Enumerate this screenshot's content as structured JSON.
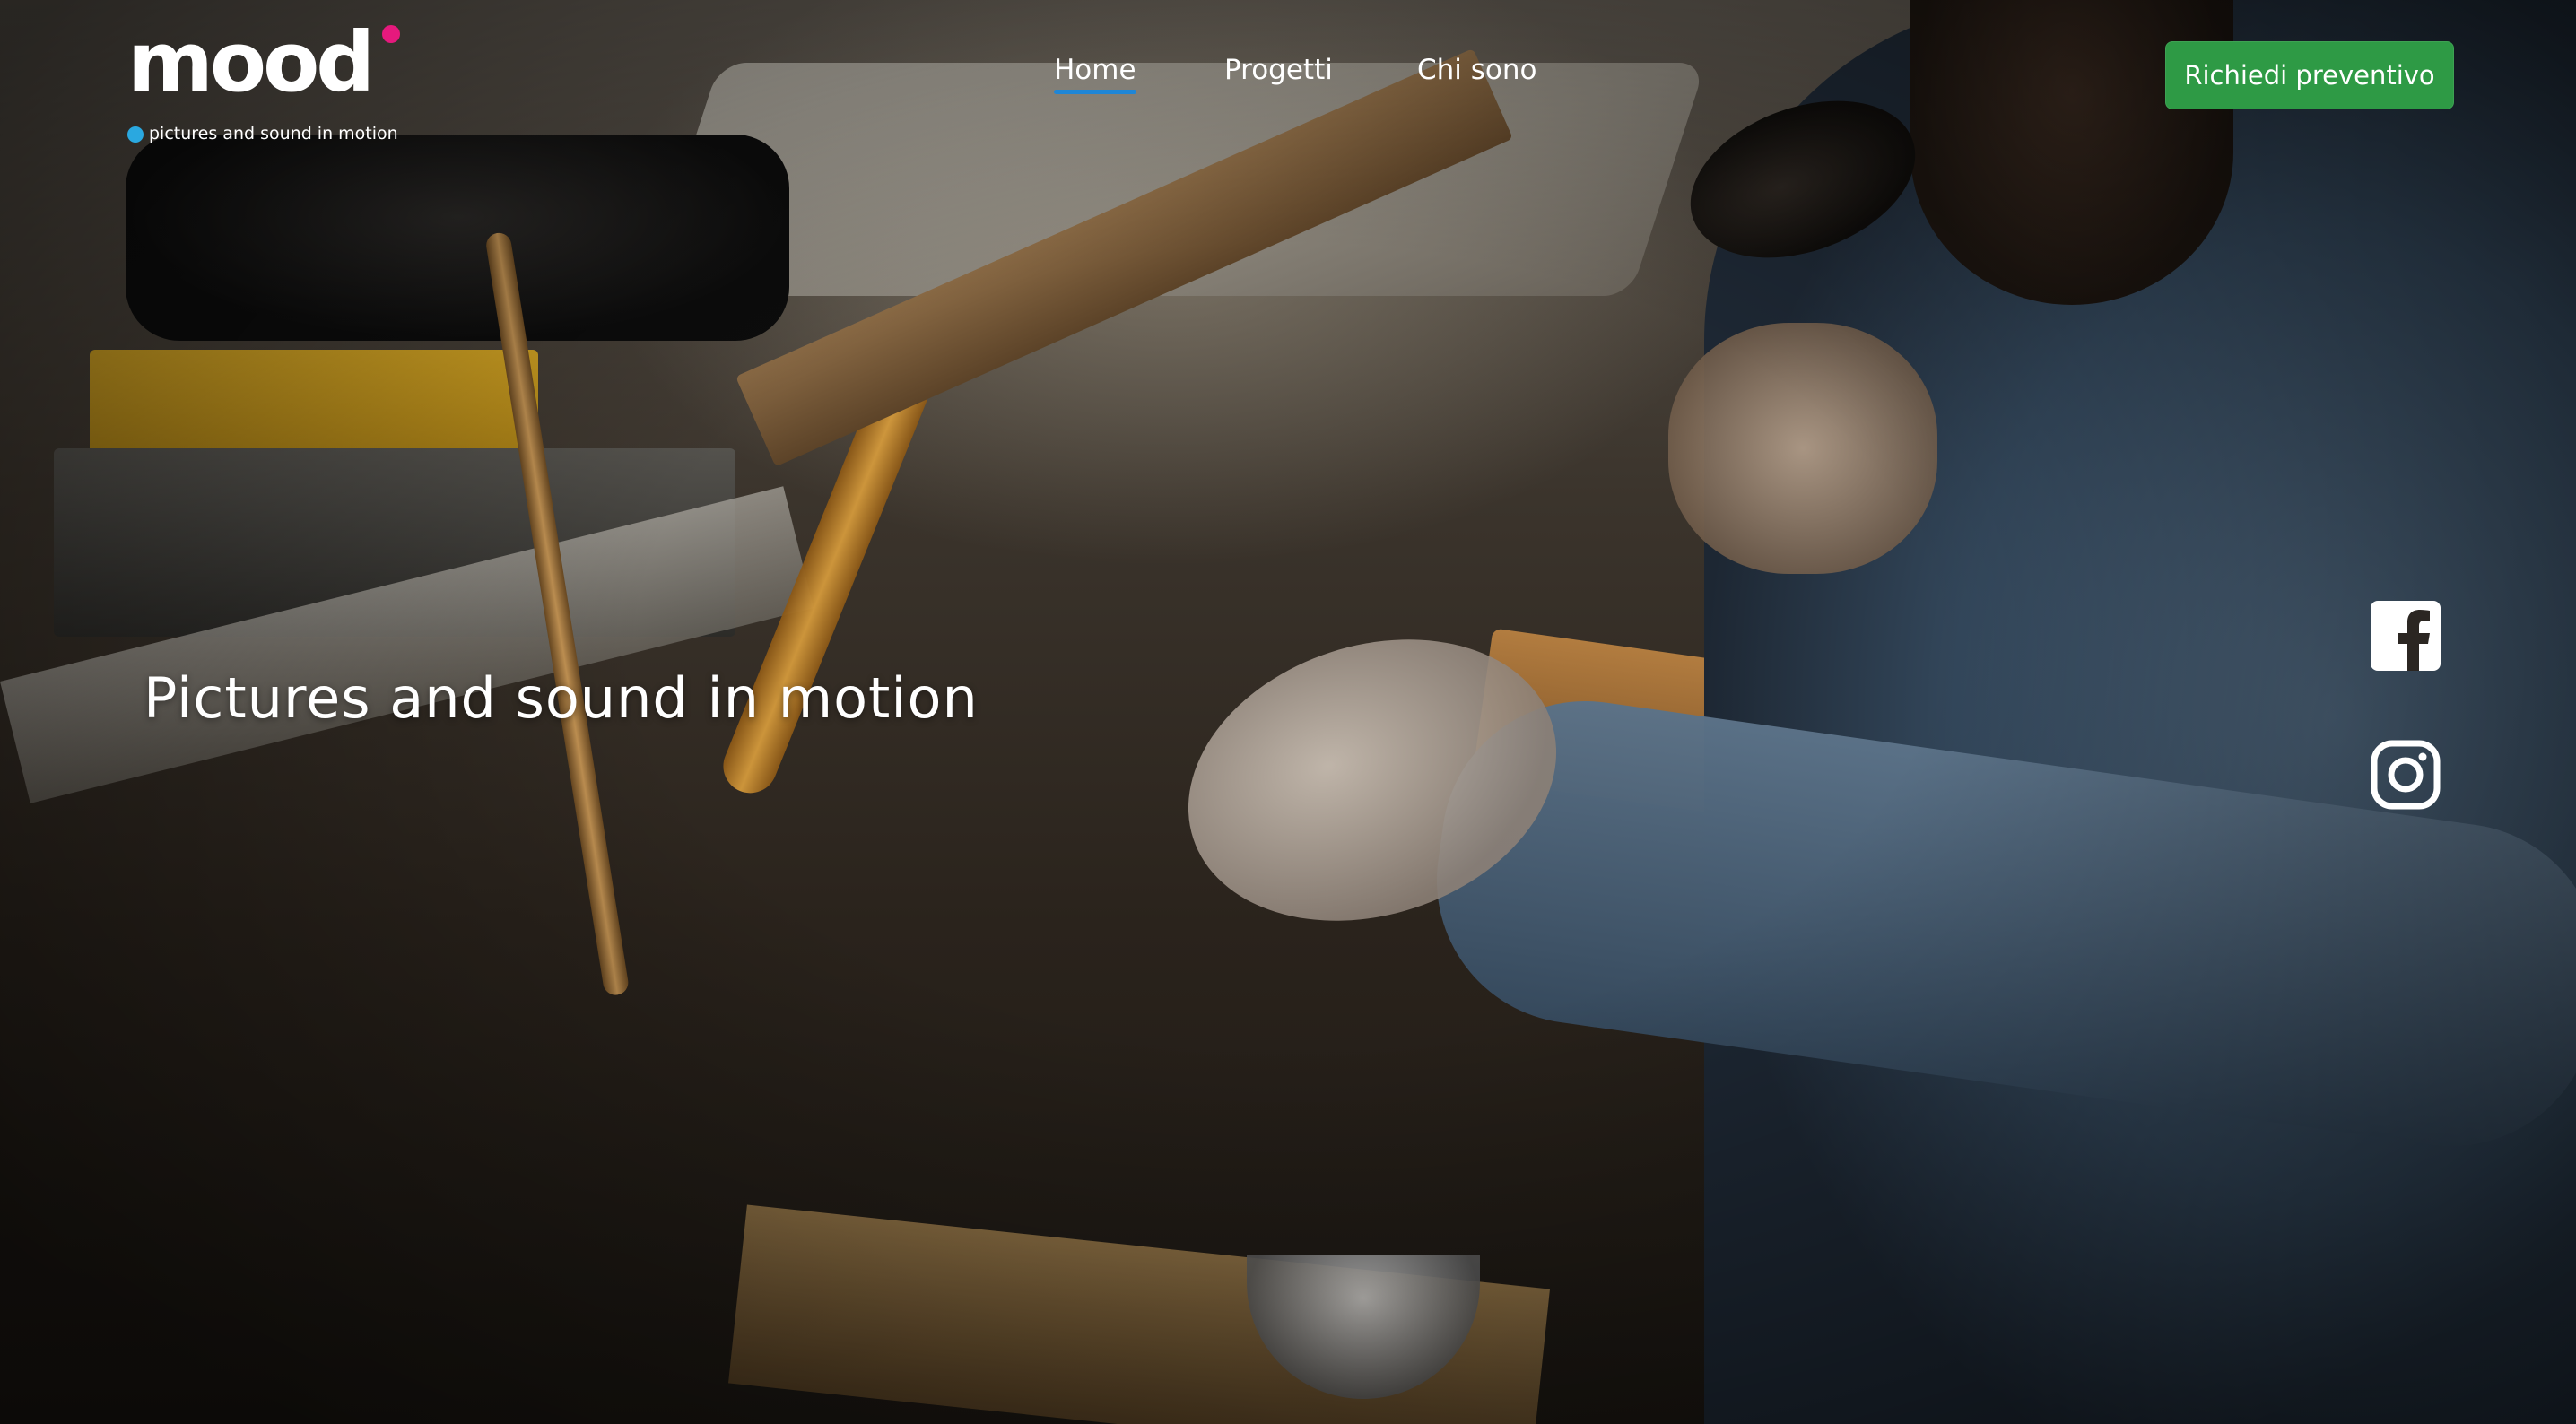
{
  "logo": {
    "wordmark": "mood",
    "tagline": "pictures and sound in motion",
    "accent_dot_color": "#e6197d",
    "tag_dot_color": "#2aa8e0"
  },
  "nav": {
    "items": [
      {
        "label": "Home",
        "active": true
      },
      {
        "label": "Progetti",
        "active": false
      },
      {
        "label": "Chi sono",
        "active": false
      }
    ],
    "active_underline_color": "#1f86d6"
  },
  "cta": {
    "label": "Richiedi preventivo",
    "color": "#2e9a45"
  },
  "hero": {
    "title": "Pictures and sound in motion"
  },
  "social": {
    "icons": [
      "facebook-icon",
      "instagram-icon"
    ]
  }
}
